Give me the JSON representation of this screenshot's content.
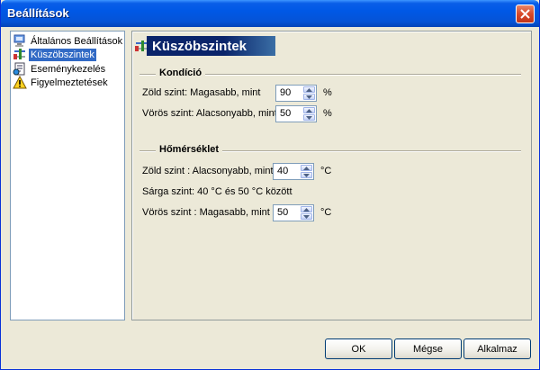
{
  "window": {
    "title": "Beállítások"
  },
  "tree": {
    "items": [
      {
        "label": "Általános Beállítások",
        "icon": "computer-settings-icon"
      },
      {
        "label": "Küszöbszintek",
        "icon": "threshold-icon"
      },
      {
        "label": "Eseménykezelés",
        "icon": "event-document-icon"
      },
      {
        "label": "Figyelmeztetések",
        "icon": "warning-icon"
      }
    ]
  },
  "page": {
    "title": "Küszöbszintek",
    "kondicio": {
      "heading": "Kondíció",
      "green_label": "Zöld szint: Magasabb, mint",
      "green_value": "90",
      "green_unit": "%",
      "red_label": "Vörös szint: Alacsonyabb, mint",
      "red_value": "50",
      "red_unit": "%"
    },
    "homerseklet": {
      "heading": "Hőmérséklet",
      "green_label": "Zöld szint : Alacsonyabb, mint",
      "green_value": "40",
      "green_unit": "°C",
      "yellow_text": "Sárga szint: 40 °C és 50 °C között",
      "red_label": "Vörös szint : Magasabb, mint",
      "red_value": "50",
      "red_unit": "°C"
    }
  },
  "buttons": {
    "ok": "OK",
    "cancel": "Mégse",
    "apply": "Alkalmaz"
  },
  "colors": {
    "title_bar": "#0058e6",
    "selection": "#316ac5",
    "header_bg": "#0a246a"
  }
}
